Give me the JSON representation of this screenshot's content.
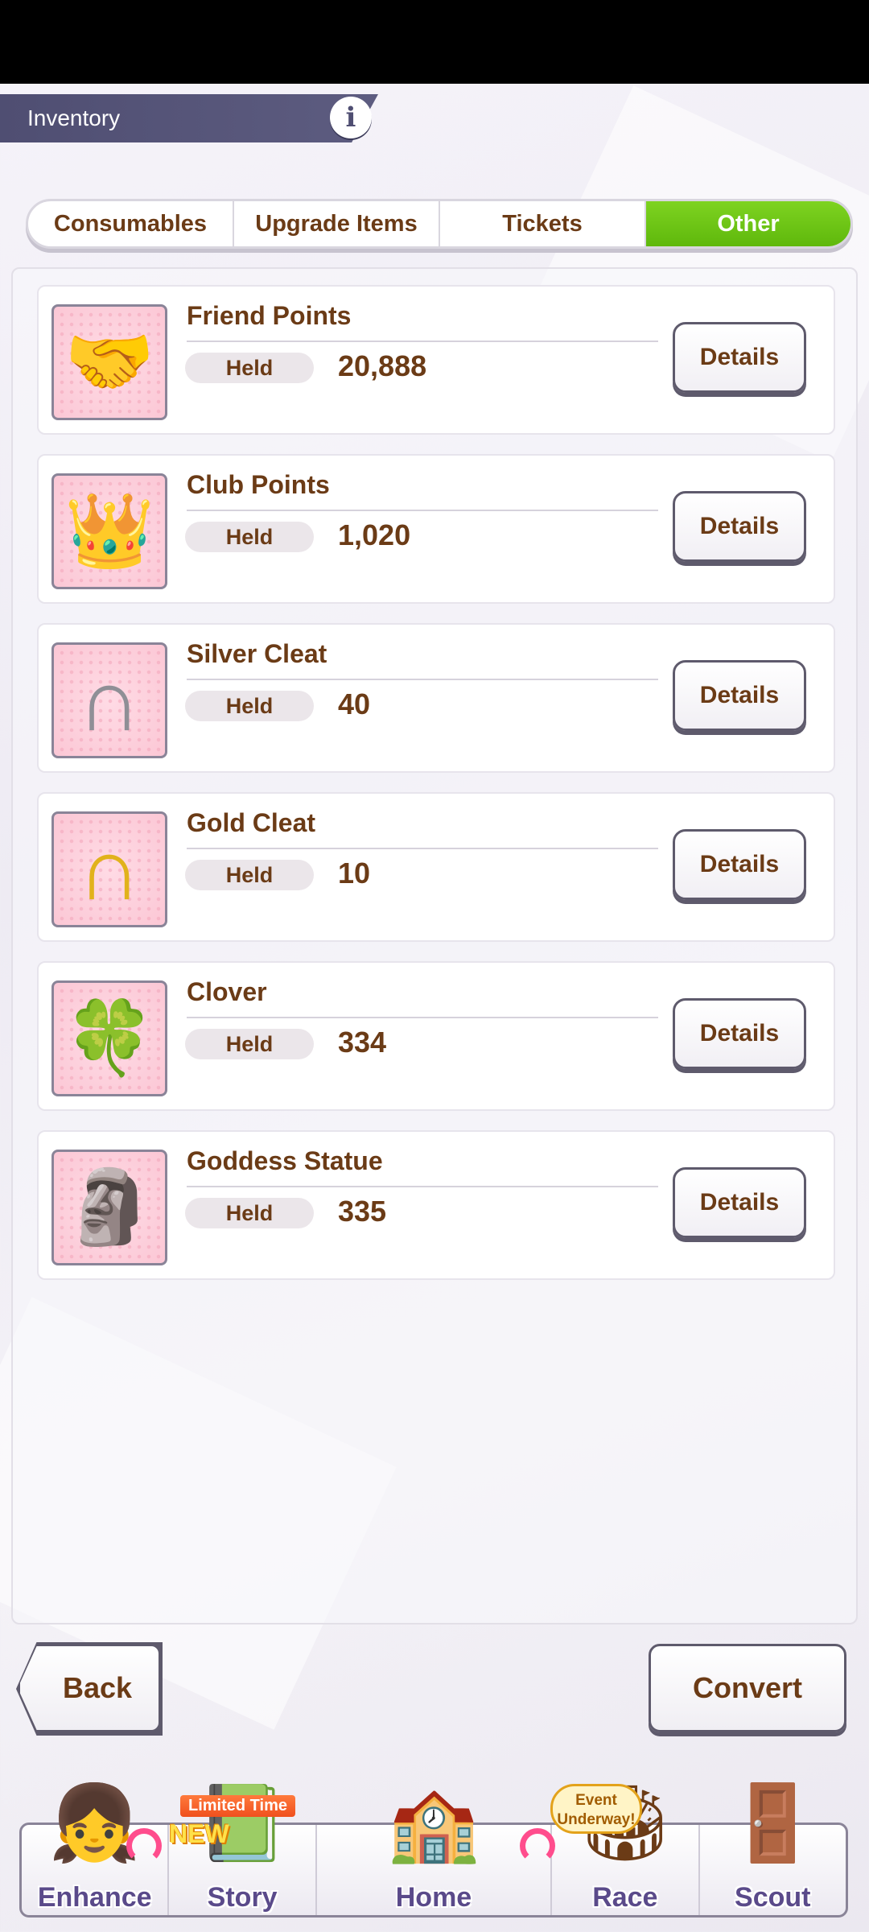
{
  "header": {
    "title": "Inventory",
    "info_icon": "i"
  },
  "tabs": [
    {
      "label": "Consumables",
      "active": false
    },
    {
      "label": "Upgrade Items",
      "active": false
    },
    {
      "label": "Tickets",
      "active": false
    },
    {
      "label": "Other",
      "active": true
    }
  ],
  "items": [
    {
      "name": "Friend Points",
      "held_label": "Held",
      "held_value": "20,888",
      "button": "Details",
      "icon": "handshake-icon",
      "glyph": "🤝"
    },
    {
      "name": "Club Points",
      "held_label": "Held",
      "held_value": "1,020",
      "button": "Details",
      "icon": "crown-icon",
      "glyph": "👑"
    },
    {
      "name": "Silver Cleat",
      "held_label": "Held",
      "held_value": "40",
      "button": "Details",
      "icon": "silver-horseshoe-icon",
      "glyph": "∩"
    },
    {
      "name": "Gold Cleat",
      "held_label": "Held",
      "held_value": "10",
      "button": "Details",
      "icon": "gold-horseshoe-icon",
      "glyph": "∩"
    },
    {
      "name": "Clover",
      "held_label": "Held",
      "held_value": "334",
      "button": "Details",
      "icon": "clover-icon",
      "glyph": "🍀"
    },
    {
      "name": "Goddess Statue",
      "held_label": "Held",
      "held_value": "335",
      "button": "Details",
      "icon": "statue-icon",
      "glyph": "🗿"
    }
  ],
  "footer": {
    "back_label": "Back",
    "convert_label": "Convert"
  },
  "bottom_nav": [
    {
      "label": "Enhance",
      "icon": "character-icon",
      "glyph": "👧"
    },
    {
      "label": "Story",
      "icon": "book-icon",
      "glyph": "📗"
    },
    {
      "label": "Home",
      "icon": "building-icon",
      "glyph": "🏫"
    },
    {
      "label": "Race",
      "icon": "gate-icon",
      "glyph": "🏟"
    },
    {
      "label": "Scout",
      "icon": "door-icon",
      "glyph": "🚪"
    }
  ],
  "badges": {
    "limited": "Limited Time",
    "new": "NEW",
    "event": "Event Underway!"
  },
  "colors": {
    "accent_green": "#6cc416",
    "text_brown": "#6b3b16",
    "header_bg": "#4f4e72",
    "icon_bg": "#fbc7d5"
  }
}
